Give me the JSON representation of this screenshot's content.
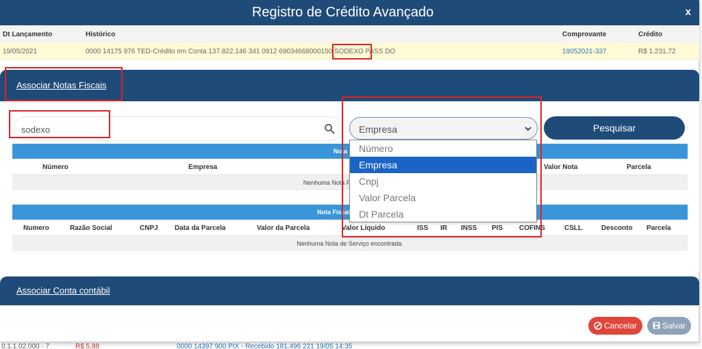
{
  "background": {
    "row_left": "0.1.1.02.000 · 7",
    "row_value": "R$ 5,88",
    "row_desc": "0000 14397 900 PIX - Recebido 181.496 221 19/05 14:35"
  },
  "modal": {
    "title": "Registro de Crédito Avançado",
    "close_label": "x"
  },
  "transaction": {
    "headers": {
      "date": "Dt Lançamento",
      "history": "Histórico",
      "receipt": "Comprovante",
      "credit": "Crédito"
    },
    "row": {
      "date": "19/05/2021",
      "history": "0000 14175 976 TED-Crédito em Conta 137.822.146 341 0912 69034668000150 SODEXO PASS DO",
      "receipt": "19052021-337",
      "credit": "R$ 1.231,72"
    }
  },
  "invoices_section": {
    "title": "Associar Notas Fiscais",
    "search_value": "sodexo",
    "filter_selected": "Empresa",
    "search_button": "Pesquisar",
    "filter_options": [
      "Número",
      "Empresa",
      "Cnpj",
      "Valor Parcela",
      "Dt Parcela"
    ]
  },
  "table1": {
    "title": "Nota Fiscal",
    "columns": [
      "Número",
      "Empresa",
      "Valor Nota",
      "Parcela"
    ],
    "empty": "Nenhuma Nota Fiscal encontrada."
  },
  "table2": {
    "title": "Nota Fiscal de Serviço",
    "columns": [
      "Numero",
      "Razão Social",
      "CNPJ",
      "Data da Parcela",
      "Valor da Parcela",
      "Valor Líquido",
      "ISS",
      "IR",
      "INSS",
      "PIS",
      "COFINS",
      "CSLL",
      "Desconto",
      "Parcela"
    ],
    "empty": "Nenhuma Nota de Serviço encontrada."
  },
  "account_section": {
    "title": "Associar Conta contábil"
  },
  "footer": {
    "cancel": "Cancelar",
    "save": "Salvar"
  },
  "colors": {
    "navy": "#1f4b79",
    "table_blue": "#3a95d8",
    "highlight_row": "#fffbd6",
    "cancel_red": "#e0463a",
    "save_gray": "#8fa2b8",
    "annotation_red": "#e02020"
  },
  "icons": [
    "close-icon",
    "search-icon",
    "chevron-down-icon",
    "cancel-icon",
    "save-icon"
  ]
}
